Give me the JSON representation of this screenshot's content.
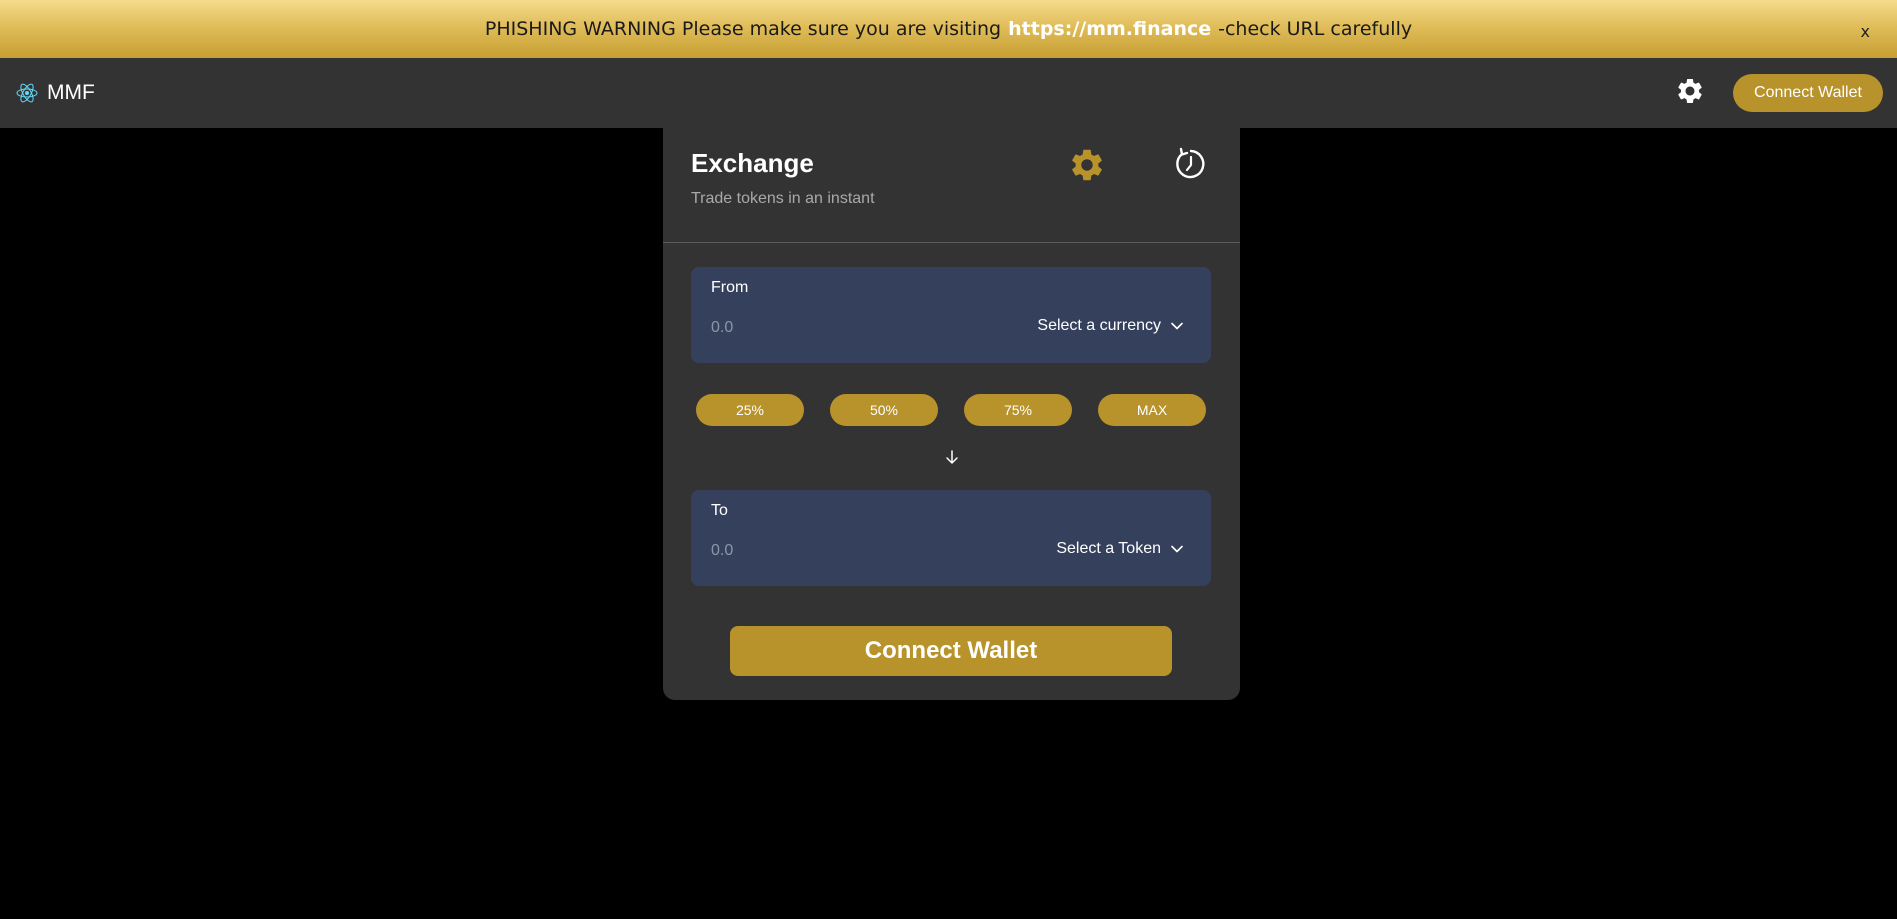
{
  "banner": {
    "prefix": "PHISHING WARNING Please make sure you are visiting",
    "url": "https://mm.finance",
    "suffix": "-check URL carefully",
    "close_label": "x"
  },
  "nav": {
    "logo_text": "MMF",
    "connect_label": "Connect Wallet",
    "settings_icon": "gear-icon",
    "logo_icon": "react-atom-icon"
  },
  "exchange": {
    "title": "Exchange",
    "subtitle": "Trade tokens in an instant",
    "from": {
      "label": "From",
      "placeholder": "0.0",
      "select_label": "Select a currency"
    },
    "to": {
      "label": "To",
      "placeholder": "0.0",
      "select_label": "Select a Token"
    },
    "percent_buttons": [
      "25%",
      "50%",
      "75%",
      "MAX"
    ],
    "connect_label": "Connect Wallet"
  },
  "colors": {
    "accent": "#b8922a",
    "panel": "#35415c",
    "card": "#333333",
    "background": "#000000"
  }
}
